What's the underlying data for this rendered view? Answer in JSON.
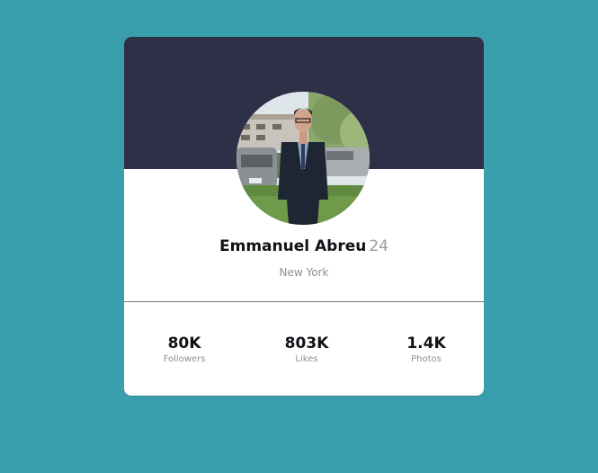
{
  "profile": {
    "name": "Emmanuel Abreu",
    "age": "24",
    "location": "New York"
  },
  "stats": [
    {
      "value": "80K",
      "label": "Followers"
    },
    {
      "value": "803K",
      "label": "Likes"
    },
    {
      "value": "1.4K",
      "label": "Photos"
    }
  ],
  "colors": {
    "background": "#3a9fad",
    "header": "#2e3048",
    "card": "#ffffff",
    "primary_text": "#111217",
    "muted_text": "#8e8f95"
  }
}
